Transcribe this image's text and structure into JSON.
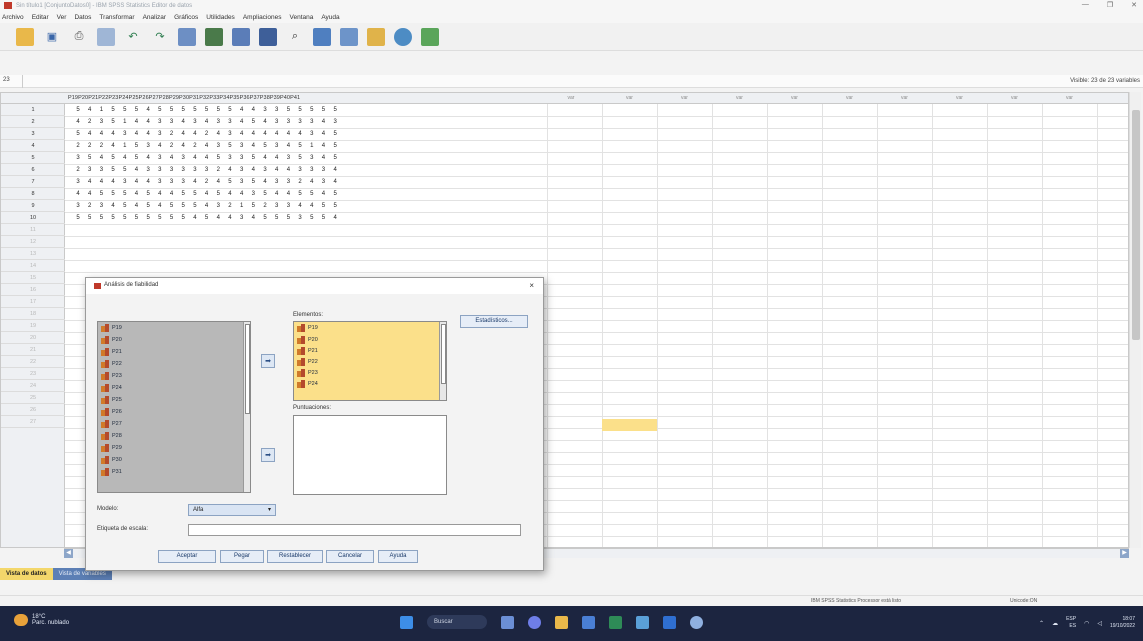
{
  "window": {
    "title": "Sin título1 [ConjuntoDatos0] - IBM SPSS Statistics Editor de datos"
  },
  "menu": [
    "Archivo",
    "Editar",
    "Ver",
    "Datos",
    "Transformar",
    "Analizar",
    "Gráficos",
    "Utilidades",
    "Ampliaciones",
    "Ventana",
    "Ayuda"
  ],
  "cellbar": {
    "ref": "23",
    "visible": "Visible: 23 de 23 variables"
  },
  "columns": [
    "P19",
    "P20",
    "P21",
    "P22",
    "P23",
    "P24",
    "P25",
    "P26",
    "P27",
    "P28",
    "P29",
    "P30",
    "P31",
    "P32",
    "P33",
    "P34",
    "P35",
    "P36",
    "P37",
    "P38",
    "P39",
    "P40",
    "P41"
  ],
  "var_label": "var",
  "rows": [
    "1",
    "2",
    "3",
    "4",
    "5",
    "6",
    "7",
    "8",
    "9",
    "10",
    "11",
    "12",
    "13",
    "14",
    "15",
    "16",
    "17",
    "18",
    "19",
    "20",
    "21",
    "22",
    "23",
    "24",
    "25",
    "26",
    "27"
  ],
  "data": [
    [
      "5",
      "4",
      "1",
      "5",
      "5",
      "5",
      "4",
      "5",
      "5",
      "5",
      "5",
      "5",
      "5",
      "5",
      "4",
      "4",
      "3",
      "3",
      "5",
      "5",
      "5",
      "5",
      "5"
    ],
    [
      "4",
      "2",
      "3",
      "5",
      "1",
      "4",
      "4",
      "3",
      "3",
      "4",
      "3",
      "4",
      "3",
      "3",
      "4",
      "5",
      "4",
      "3",
      "3",
      "3",
      "3",
      "4",
      "3"
    ],
    [
      "5",
      "4",
      "4",
      "4",
      "3",
      "4",
      "4",
      "3",
      "2",
      "4",
      "4",
      "2",
      "4",
      "3",
      "4",
      "4",
      "4",
      "4",
      "4",
      "4",
      "3",
      "4",
      "5"
    ],
    [
      "2",
      "2",
      "2",
      "4",
      "1",
      "5",
      "3",
      "4",
      "2",
      "4",
      "2",
      "4",
      "3",
      "5",
      "3",
      "4",
      "5",
      "3",
      "4",
      "5",
      "1",
      "4",
      "5"
    ],
    [
      "3",
      "5",
      "4",
      "5",
      "4",
      "5",
      "4",
      "3",
      "4",
      "3",
      "4",
      "4",
      "5",
      "3",
      "3",
      "5",
      "4",
      "4",
      "3",
      "5",
      "3",
      "4",
      "5"
    ],
    [
      "2",
      "3",
      "3",
      "5",
      "5",
      "4",
      "3",
      "3",
      "3",
      "3",
      "3",
      "3",
      "2",
      "4",
      "3",
      "4",
      "3",
      "4",
      "4",
      "3",
      "3",
      "3",
      "4"
    ],
    [
      "3",
      "4",
      "4",
      "4",
      "3",
      "4",
      "4",
      "3",
      "3",
      "3",
      "4",
      "2",
      "4",
      "5",
      "3",
      "5",
      "4",
      "3",
      "3",
      "2",
      "4",
      "3",
      "4"
    ],
    [
      "4",
      "4",
      "5",
      "5",
      "5",
      "4",
      "5",
      "4",
      "4",
      "5",
      "5",
      "4",
      "5",
      "4",
      "4",
      "3",
      "5",
      "4",
      "4",
      "5",
      "5",
      "4",
      "5"
    ],
    [
      "3",
      "2",
      "3",
      "4",
      "5",
      "4",
      "5",
      "4",
      "5",
      "5",
      "5",
      "4",
      "3",
      "2",
      "1",
      "5",
      "2",
      "3",
      "3",
      "4",
      "4",
      "5",
      "5"
    ],
    [
      "5",
      "5",
      "5",
      "5",
      "5",
      "5",
      "5",
      "5",
      "5",
      "5",
      "4",
      "5",
      "4",
      "4",
      "3",
      "4",
      "5",
      "5",
      "5",
      "3",
      "5",
      "5",
      "4"
    ]
  ],
  "dialog": {
    "title": "Análisis de fiabilidad",
    "close": "×",
    "source_items": [
      "P19",
      "P20",
      "P21",
      "P22",
      "P23",
      "P24",
      "P25",
      "P26",
      "P27",
      "P28",
      "P29",
      "P30",
      "P31"
    ],
    "elements_label": "Elementos:",
    "elements": [
      "P19",
      "P20",
      "P21",
      "P22",
      "P23",
      "P24"
    ],
    "scores_label": "Puntuaciones:",
    "stats_button": "Estadísticos...",
    "model_label": "Modelo:",
    "model_value": "Alfa",
    "scale_label": "Etiqueta de escala:",
    "buttons": [
      "Aceptar",
      "Pegar",
      "Restablecer",
      "Cancelar",
      "Ayuda"
    ]
  },
  "tabs": {
    "data_view": "Vista de datos",
    "var_view": "Vista de variables"
  },
  "status": {
    "processor": "IBM SPSS Statistics Processor está listo",
    "unicode": "Unicode:ON"
  },
  "taskbar": {
    "temp": "18°C",
    "weather": "Parc. nublado",
    "search": "Buscar",
    "lang": "ESP",
    "lang2": "ES",
    "time": "18:07",
    "date": "19/10/2022"
  },
  "colors": {
    "accent": "#fbe08a",
    "tab_active": "#f3d76b",
    "tab_other": "#5c7fb5",
    "taskbar": "#1c2540"
  }
}
